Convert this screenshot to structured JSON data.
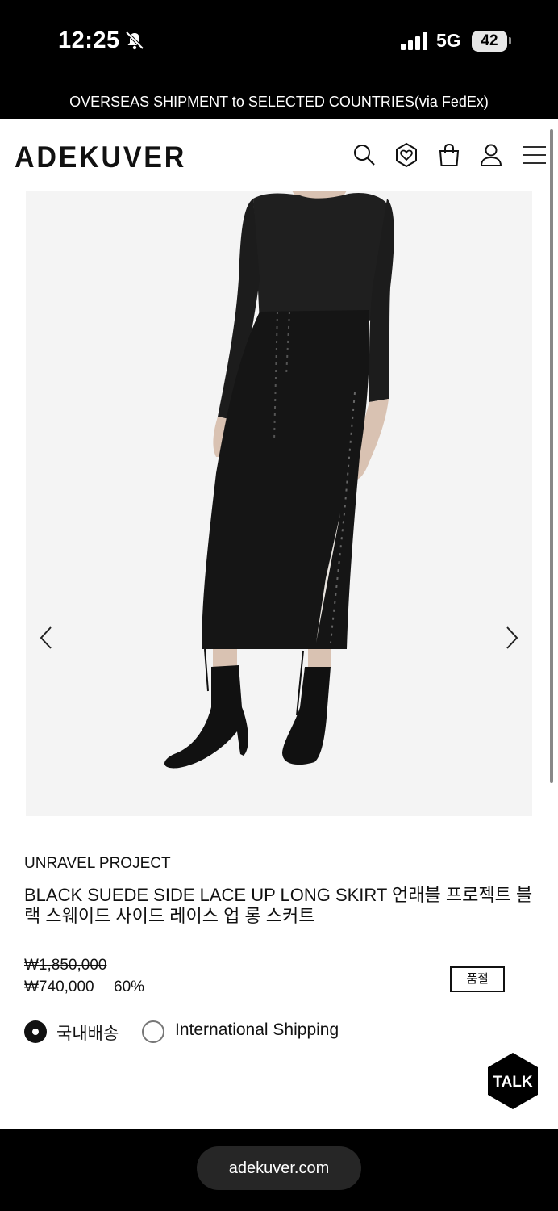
{
  "status_bar": {
    "time": "12:25",
    "network": "5G",
    "battery": "42"
  },
  "promo_banner": {
    "text": "OVERSEAS SHIPMENT to SELECTED COUNTRIES(via FedEx)"
  },
  "header": {
    "logo": "ADEKUVER",
    "icons": [
      "search-icon",
      "wishlist-heart-icon",
      "shopping-bag-icon",
      "user-icon",
      "menu-icon"
    ]
  },
  "product": {
    "brand": "UNRAVEL PROJECT",
    "name": "BLACK SUEDE SIDE LACE UP LONG SKIRT 언래블 프로젝트 블랙 스웨이드 사이드 레이스 업 롱 스커트",
    "price_original": "₩1,850,000",
    "price_sale": "₩740,000",
    "discount": "60%",
    "sold_out_label": "품절"
  },
  "shipping_options": [
    {
      "label": "국내배송",
      "selected": true
    },
    {
      "label": "International Shipping",
      "selected": false
    }
  ],
  "talk_button": {
    "label": "TALK"
  },
  "browser": {
    "url": "adekuver.com"
  },
  "colors": {
    "background": "#ffffff",
    "bars": "#000000",
    "text": "#111111",
    "image_background": "#f4f4f4"
  }
}
